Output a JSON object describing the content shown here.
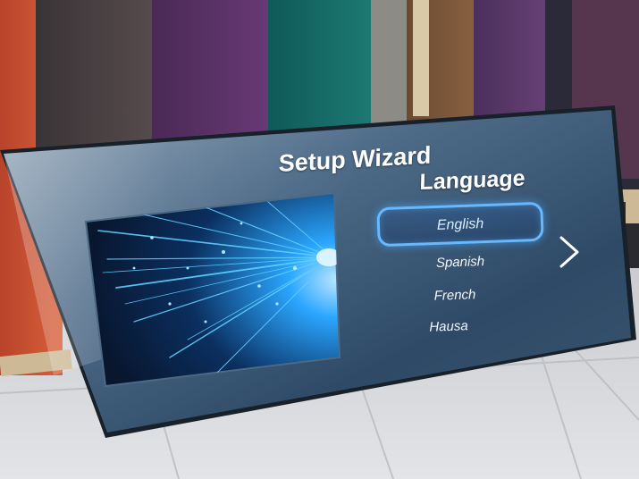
{
  "setup": {
    "title": "Setup Wizard",
    "section": "Language",
    "languages": [
      "English",
      "Spanish",
      "French",
      "Hausa"
    ],
    "selected_language": "English"
  },
  "icons": {
    "next": "chevron-right-icon"
  },
  "colors": {
    "screen_blue": "#2d4a66",
    "highlight": "#67b8ff",
    "floor": "#d8dadd"
  }
}
